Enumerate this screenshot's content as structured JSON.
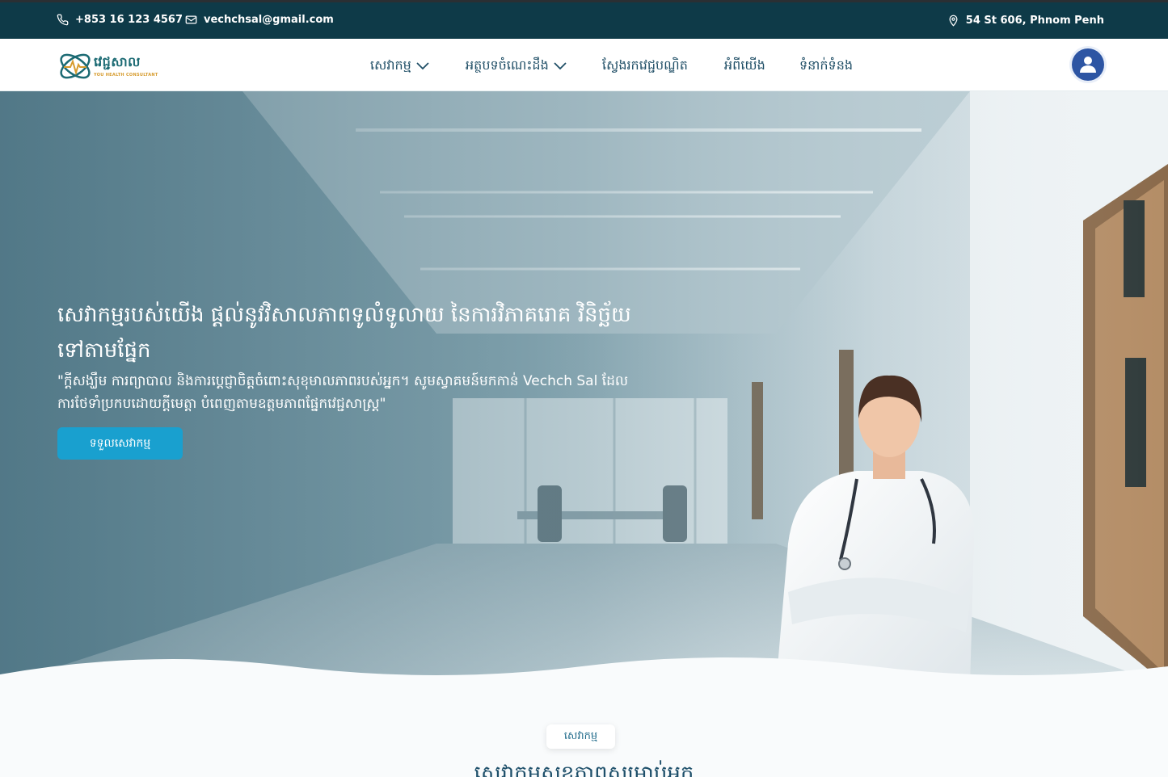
{
  "topbar": {
    "phone": "+853 16 123 4567",
    "email": "vechchsal@gmail.com",
    "address": "54 St 606, Phnom Penh"
  },
  "brand": {
    "name": "វេជ្ជសាល",
    "tagline": "YOU HEALTH CONSULTANT"
  },
  "nav": {
    "items": [
      {
        "label": "សេវាកម្ម",
        "dropdown": true
      },
      {
        "label": "អត្ថបទចំណេះដឹង",
        "dropdown": true
      },
      {
        "label": "ស្វែងរកវេជ្ជបណ្ឌិត",
        "dropdown": false
      },
      {
        "label": "អំពីយើង",
        "dropdown": false
      },
      {
        "label": "ទំនាក់ទំនង",
        "dropdown": false
      }
    ]
  },
  "hero": {
    "title": "សេវាកម្មរបស់យើង ផ្តល់នូវវិសាលភាពទូលំទូលាយ នៃការវិភាគរោគ វិនិច្ឆ័យទៅតាមផ្នែក",
    "subtitle": "\"ក្តីសង្ឃឹម ការព្យាបាល និងការប្តេជ្ញាចិត្តចំពោះសុខុមាលភាពរបស់អ្នក។ សូមស្វាគមន៍មកកាន់ Vechch Sal ដែលការថែទាំប្រកបដោយក្តីមេត្តា បំពេញតាមឧត្តមភាពផ្នែកវេជ្ជសាស្ត្រ\"",
    "cta": "ទទួលសេវាកម្ម"
  },
  "services": {
    "badge": "សេវាកម្ម",
    "title": "សេវាកម្មសុខភាពសម្រាប់អ្នក"
  },
  "colors": {
    "topbar": "#0e3a48",
    "accent": "#19a0cf",
    "nav_text": "#1f4e66",
    "avatar": "#2d55a3"
  }
}
